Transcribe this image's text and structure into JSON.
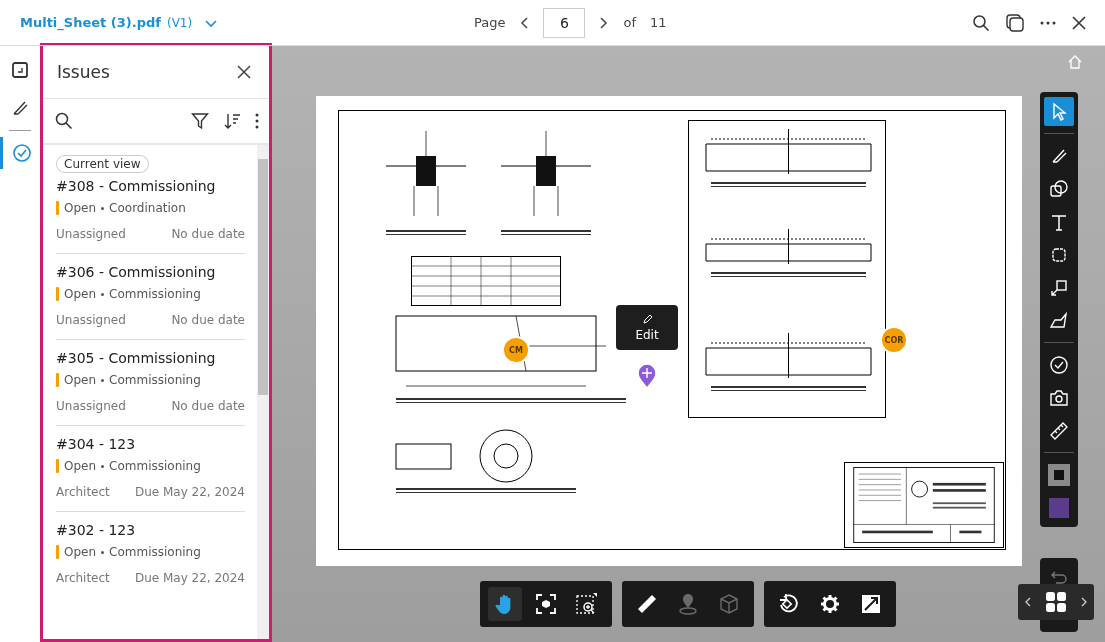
{
  "header": {
    "file_name": "Multi_Sheet (3).pdf",
    "version": "(V1)",
    "page_label": "Page",
    "page": "6",
    "of_label": "of",
    "page_count": "11"
  },
  "left_rail": [
    {
      "kind": "sheets",
      "selected": false
    },
    {
      "kind": "markup",
      "selected": false
    },
    {
      "kind": "issues",
      "selected": true
    }
  ],
  "issues_panel": {
    "title": "Issues",
    "filter_chip": "Current view",
    "issues": [
      {
        "title": "#308 - Commissioning",
        "status": "Open",
        "color": "#f5a000",
        "type": "Coordination",
        "assignee": "Unassigned",
        "due": "No due date"
      },
      {
        "title": "#306 - Commissioning",
        "status": "Open",
        "color": "#f5a000",
        "type": "Commissioning",
        "assignee": "Unassigned",
        "due": "No due date"
      },
      {
        "title": "#305 - Commissioning",
        "status": "Open",
        "color": "#f5a000",
        "type": "Commissioning",
        "assignee": "Unassigned",
        "due": "No due date"
      },
      {
        "title": "#304 - 123",
        "status": "Open",
        "color": "#f5a000",
        "type": "Commissioning",
        "assignee": "Architect",
        "due": "Due May 22, 2024"
      },
      {
        "title": "#302 - 123",
        "status": "Open",
        "color": "#f5a000",
        "type": "Commissioning",
        "assignee": "Architect",
        "due": "Due May 22, 2024"
      }
    ]
  },
  "markers": [
    {
      "label": "CM",
      "color": "#f5a000"
    },
    {
      "label": "COR",
      "color": "#f5a000"
    }
  ],
  "edit_tooltip": "Edit",
  "right_tools": [
    {
      "kind": "select",
      "selected": true
    },
    {
      "kind": "pen",
      "selected": false
    },
    {
      "kind": "shapes",
      "selected": false
    },
    {
      "kind": "text",
      "selected": false
    },
    {
      "kind": "cloud",
      "selected": false
    },
    {
      "kind": "callout",
      "selected": false
    },
    {
      "kind": "polygon",
      "selected": false
    },
    {
      "kind": "issue",
      "selected": false
    },
    {
      "kind": "camera",
      "selected": false
    },
    {
      "kind": "ruler",
      "selected": false
    },
    {
      "kind": "stroke",
      "selected": false,
      "color": "#8a8a8a"
    },
    {
      "kind": "fill",
      "selected": false,
      "color": "#5b3b8c"
    }
  ],
  "bottom_tools": [
    [
      {
        "kind": "pan",
        "selected": true,
        "disabled": false
      },
      {
        "kind": "fit",
        "selected": false,
        "disabled": false
      },
      {
        "kind": "zoom",
        "selected": false,
        "disabled": false
      }
    ],
    [
      {
        "kind": "measure",
        "selected": false,
        "disabled": false
      },
      {
        "kind": "location",
        "selected": false,
        "disabled": true
      },
      {
        "kind": "model",
        "selected": false,
        "disabled": true
      }
    ],
    [
      {
        "kind": "rotate",
        "selected": false,
        "disabled": false
      },
      {
        "kind": "settings",
        "selected": false,
        "disabled": false
      },
      {
        "kind": "fullscreen",
        "selected": false,
        "disabled": false
      }
    ]
  ]
}
